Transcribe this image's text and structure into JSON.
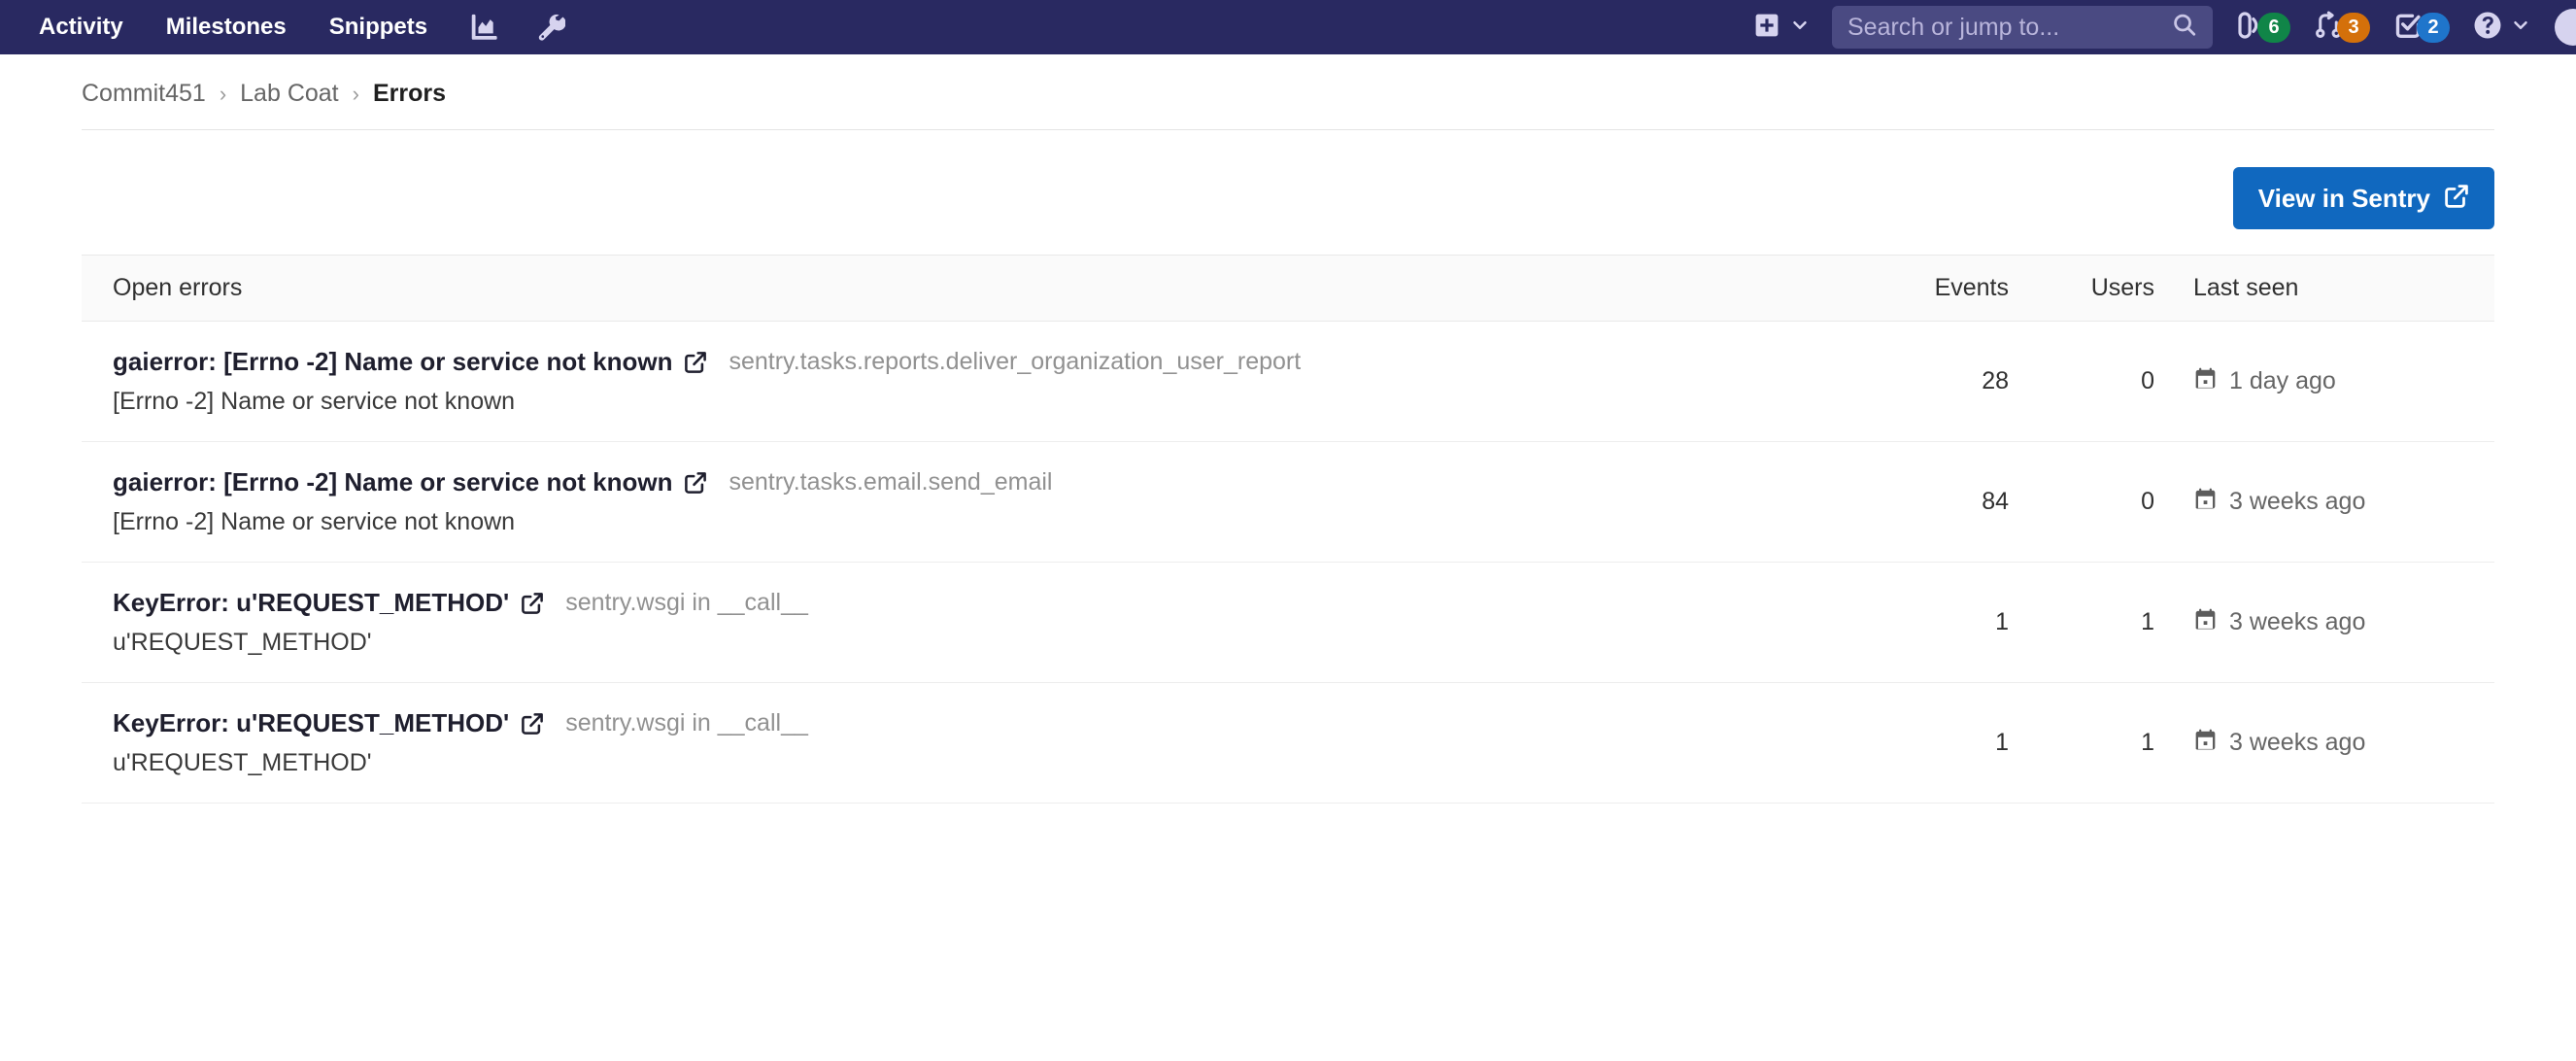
{
  "navbar": {
    "links": [
      {
        "label": "Activity",
        "name": "nav-link-activity"
      },
      {
        "label": "Milestones",
        "name": "nav-link-milestones"
      },
      {
        "label": "Snippets",
        "name": "nav-link-snippets"
      }
    ],
    "icons": [
      {
        "name": "analytics-icon",
        "label": "Analytics"
      },
      {
        "name": "wrench-icon",
        "label": "Admin"
      }
    ],
    "create_new_label": "Create new",
    "search": {
      "placeholder": "Search or jump to...",
      "value": "",
      "icon": "search-icon"
    },
    "counters": [
      {
        "name": "issues-counter",
        "icon": "issues-icon",
        "count": "6",
        "color": "#108548"
      },
      {
        "name": "merge-requests-counter",
        "icon": "merge-request-icon",
        "count": "3",
        "color": "#d4700a"
      },
      {
        "name": "todos-counter",
        "icon": "todo-check-icon",
        "count": "2",
        "color": "#1f75cb"
      }
    ],
    "help": {
      "name": "help-icon",
      "label": "Help"
    },
    "avatar_label": "User menu",
    "background_color": "#292961",
    "search_background": "#4a4a82"
  },
  "breadcrumb": {
    "items": [
      {
        "label": "Commit451",
        "current": false
      },
      {
        "label": "Lab Coat",
        "current": false
      },
      {
        "label": "Errors",
        "current": true
      }
    ],
    "separator": "›"
  },
  "actions": {
    "view_in_sentry_label": "View in Sentry",
    "view_in_sentry_icon": "external-link-icon",
    "accent_color": "#1068bf"
  },
  "table": {
    "headers": {
      "title": "Open errors",
      "events": "Events",
      "users": "Users",
      "last_seen": "Last seen"
    },
    "rows": [
      {
        "title": "gaierror: [Errno -2] Name or service not known",
        "culprit": "sentry.tasks.reports.deliver_organization_user_report",
        "subtitle": "[Errno -2] Name or service not known",
        "events": "28",
        "users": "0",
        "last_seen": "1 day ago",
        "last_seen_icon": "calendar-icon",
        "link_icon": "external-link-icon"
      },
      {
        "title": "gaierror: [Errno -2] Name or service not known",
        "culprit": "sentry.tasks.email.send_email",
        "subtitle": "[Errno -2] Name or service not known",
        "events": "84",
        "users": "0",
        "last_seen": "3 weeks ago",
        "last_seen_icon": "calendar-icon",
        "link_icon": "external-link-icon"
      },
      {
        "title": "KeyError: u'REQUEST_METHOD'",
        "culprit": "sentry.wsgi in __call__",
        "subtitle": "u'REQUEST_METHOD'",
        "events": "1",
        "users": "1",
        "last_seen": "3 weeks ago",
        "last_seen_icon": "calendar-icon",
        "link_icon": "external-link-icon"
      },
      {
        "title": "KeyError: u'REQUEST_METHOD'",
        "culprit": "sentry.wsgi in __call__",
        "subtitle": "u'REQUEST_METHOD'",
        "events": "1",
        "users": "1",
        "last_seen": "3 weeks ago",
        "last_seen_icon": "calendar-icon",
        "link_icon": "external-link-icon"
      }
    ]
  }
}
